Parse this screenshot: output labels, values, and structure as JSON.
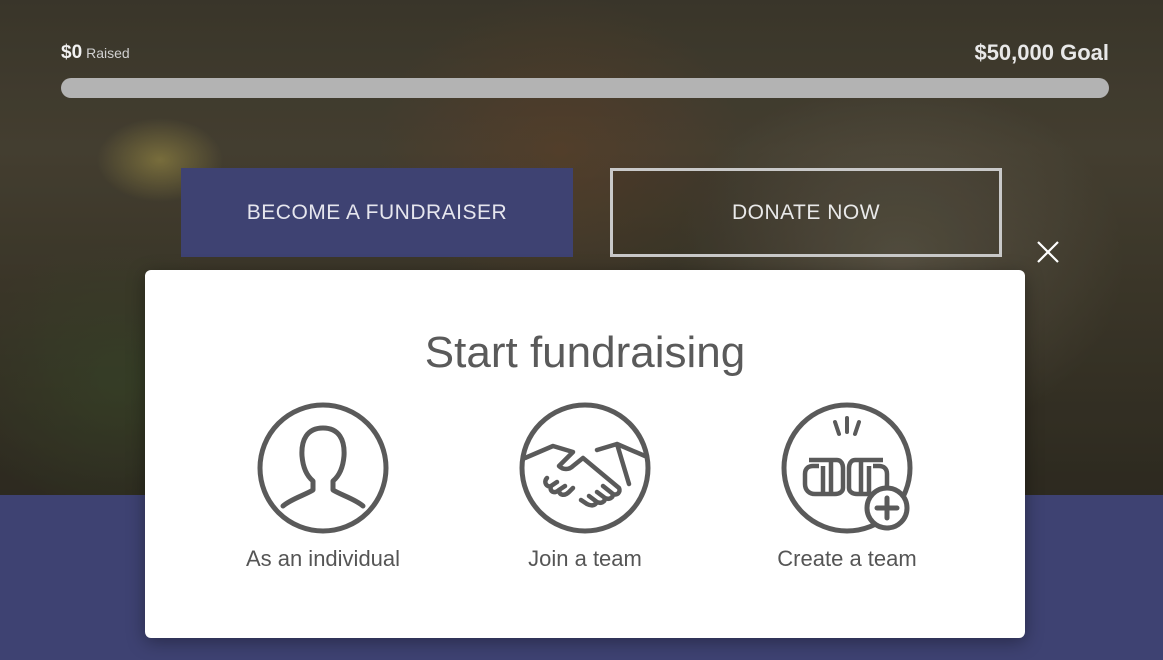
{
  "progress": {
    "raised_amount": "$0",
    "raised_label": "Raised",
    "goal_text": "$50,000 Goal",
    "fraction": 0
  },
  "hero": {
    "become_fundraiser_label": "BECOME A FUNDRAISER",
    "donate_label": "DONATE NOW"
  },
  "modal": {
    "title": "Start fundraising",
    "options": [
      {
        "label": "As an individual",
        "icon": "person-icon"
      },
      {
        "label": "Join a team",
        "icon": "handshake-icon"
      },
      {
        "label": "Create a team",
        "icon": "fist-bump-plus-icon"
      }
    ],
    "close_icon": "close-icon"
  },
  "colors": {
    "brand": "#3e4272",
    "icon": "#5a5a5a",
    "progress_track": "#b3b3b3"
  }
}
